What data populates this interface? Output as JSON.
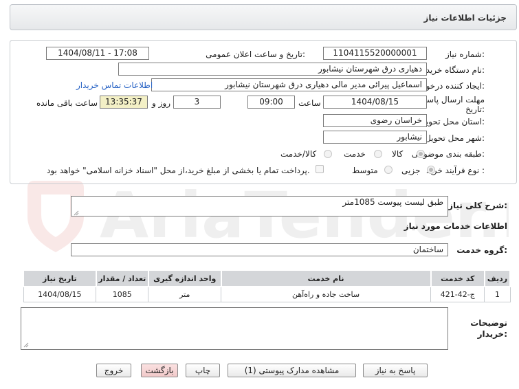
{
  "header": {
    "title": "جزئیات اطلاعات نیاز"
  },
  "fields": {
    "need_number_label": "شماره نیاز:",
    "need_number": "1104115520000001",
    "announce_label": "تاریخ و ساعت اعلان عمومی:",
    "announce_value": "1404/08/11 - 17:08",
    "buyer_org_label": "نام دستگاه خریدار:",
    "buyer_org": "دهیاری درق  شهرستان نیشابور",
    "requester_label": "ایجاد کننده درخواست:",
    "requester": "اسماعیل پیرائی مدیر مالی دهیاری درق  شهرستان نیشابور",
    "contact_link": "اطلاعات تماس خریدار",
    "deadline_label_1": "مهلت ارسال پاسخ: تا",
    "deadline_label_2": "تاریخ:",
    "deadline_date": "1404/08/15",
    "time_label": "ساعت",
    "deadline_time": "09:00",
    "days_value": "3",
    "days_label": "روز و",
    "remaining_time": "13:35:37",
    "remaining_label": "ساعت باقی مانده",
    "province_label": "استان محل تحویل:",
    "province": "خراسان رضوی",
    "city_label": "شهر محل تحویل:",
    "city": "نیشابور",
    "category_label": "طبقه بندی موضوعی:",
    "category_options": [
      "کالا",
      "خدمت",
      "کالا/خدمت"
    ],
    "process_label": "نوع فرآیند خرید :",
    "process_options": [
      "جزیی",
      "متوسط"
    ],
    "payment_note": "پرداخت تمام یا بخشی از مبلغ خرید،از محل \"اسناد خزانه اسلامی\" خواهد بود."
  },
  "summary": {
    "label": "شرح کلی نیاز:",
    "value": "طبق لیست پیوست 1085متر"
  },
  "services": {
    "section_title": "اطلاعات خدمات مورد نیاز",
    "group_label": "گروه خدمت:",
    "group_value": "ساختمان",
    "columns": [
      "ردیف",
      "کد خدمت",
      "نام خدمت",
      "واحد اندازه گیری",
      "تعداد / مقدار",
      "تاریخ نیاز"
    ],
    "rows": [
      {
        "row": "1",
        "code": "ج-42-421",
        "name": "ساخت جاده و راه‌آهن",
        "unit": "متر",
        "qty": "1085",
        "date": "1404/08/15"
      }
    ]
  },
  "buyer_notes": {
    "label_1": "توضیحات",
    "label_2": "خریدار:"
  },
  "buttons": {
    "reply": "پاسخ به نیاز",
    "view_docs": "مشاهده مدارک پیوستی (1)",
    "print": "چاپ",
    "back": "بازگشت",
    "exit": "خروج"
  },
  "watermark": "AriaTender.neT",
  "colors": {
    "link": "#2a64c5",
    "remaining_bg": "#f3f0c6",
    "back_btn": "#f1c9c9",
    "watermark": "#d9534f"
  }
}
